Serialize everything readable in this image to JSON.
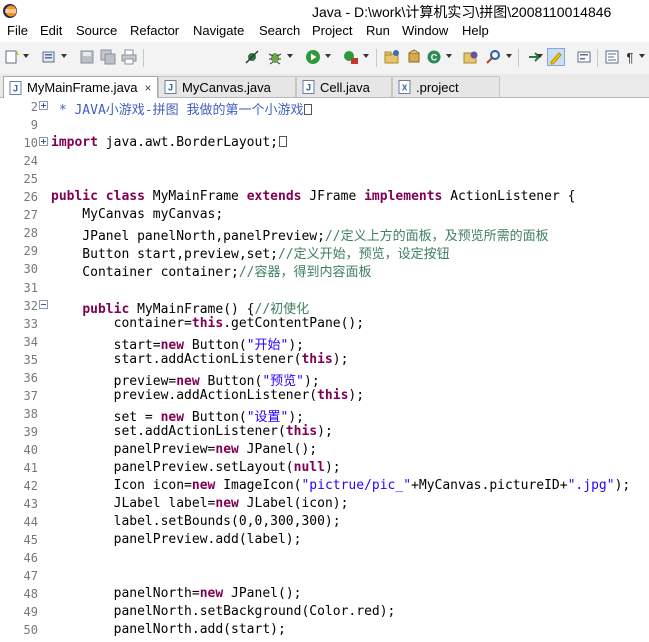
{
  "window": {
    "title": "Java - D:\\work\\计算机实习\\拼图\\2008110014846"
  },
  "menu": [
    "File",
    "Edit",
    "Source",
    "Refactor",
    "Navigate",
    "Search",
    "Project",
    "Run",
    "Window",
    "Help"
  ],
  "toolbar": {
    "icons": [
      "new-wizard-icon",
      "new-java-element-icon",
      "save-icon",
      "save-all-icon",
      "print-icon",
      "skip-breakpoints-icon",
      "debug-icon",
      "run-icon",
      "external-tools-icon",
      "new-java-project-icon",
      "new-package-icon",
      "new-class-icon",
      "open-type-icon",
      "search-icon",
      "toggle-mark-occurrences-icon",
      "show-whitespace-icon"
    ]
  },
  "tabs": [
    {
      "label": "MyMainFrame.java",
      "active": true,
      "icon": "java-file-icon",
      "close": "×"
    },
    {
      "label": "MyCanvas.java",
      "active": false,
      "icon": "java-file-icon"
    },
    {
      "label": "Cell.java",
      "active": false,
      "icon": "java-file-icon"
    },
    {
      "label": ".project",
      "active": false,
      "icon": "xml-file-icon"
    }
  ],
  "editor": {
    "lines": [
      {
        "n": "2",
        "fold": "plus",
        "parts": [
          {
            "t": " * JAVA小游戏-拼图 我做的第一个小游戏",
            "c": "jd"
          }
        ],
        "box": true
      },
      {
        "n": "9",
        "parts": []
      },
      {
        "n": "10",
        "fold": "plus",
        "parts": [
          {
            "t": "import",
            "c": "kw"
          },
          {
            "t": " java.awt.BorderLayout;",
            "c": ""
          }
        ],
        "box": true
      },
      {
        "n": "24",
        "parts": []
      },
      {
        "n": "25",
        "parts": []
      },
      {
        "n": "26",
        "parts": [
          {
            "t": "public",
            "c": "kw"
          },
          {
            "t": " ",
            "c": ""
          },
          {
            "t": "class",
            "c": "kw"
          },
          {
            "t": " MyMainFrame ",
            "c": ""
          },
          {
            "t": "extends",
            "c": "kw"
          },
          {
            "t": " JFrame ",
            "c": ""
          },
          {
            "t": "implements",
            "c": "kw"
          },
          {
            "t": " ActionListener {",
            "c": ""
          }
        ]
      },
      {
        "n": "27",
        "parts": [
          {
            "t": "    MyCanvas myCanvas;",
            "c": ""
          }
        ]
      },
      {
        "n": "28",
        "parts": [
          {
            "t": "    JPanel panelNorth,panelPreview;",
            "c": ""
          },
          {
            "t": "//定义上方的面板，及预览所需的面板",
            "c": "cm"
          }
        ]
      },
      {
        "n": "29",
        "parts": [
          {
            "t": "    Button start,preview,set;",
            "c": ""
          },
          {
            "t": "//定义开始，预览，设定按钮",
            "c": "cm"
          }
        ]
      },
      {
        "n": "30",
        "parts": [
          {
            "t": "    Container container;",
            "c": ""
          },
          {
            "t": "//容器，得到内容面板",
            "c": "cm"
          }
        ]
      },
      {
        "n": "31",
        "parts": []
      },
      {
        "n": "32",
        "fold": "minus",
        "parts": [
          {
            "t": "    ",
            "c": ""
          },
          {
            "t": "public",
            "c": "kw"
          },
          {
            "t": " MyMainFrame() {",
            "c": ""
          },
          {
            "t": "//初使化",
            "c": "cm"
          }
        ]
      },
      {
        "n": "33",
        "parts": [
          {
            "t": "        container=",
            "c": ""
          },
          {
            "t": "this",
            "c": "kw"
          },
          {
            "t": ".getContentPane();",
            "c": ""
          }
        ]
      },
      {
        "n": "34",
        "parts": [
          {
            "t": "        start=",
            "c": ""
          },
          {
            "t": "new",
            "c": "kw"
          },
          {
            "t": " Button(",
            "c": ""
          },
          {
            "t": "\"开始\"",
            "c": "st"
          },
          {
            "t": ");",
            "c": ""
          }
        ]
      },
      {
        "n": "35",
        "parts": [
          {
            "t": "        start.addActionListener(",
            "c": ""
          },
          {
            "t": "this",
            "c": "kw"
          },
          {
            "t": ");",
            "c": ""
          }
        ]
      },
      {
        "n": "36",
        "parts": [
          {
            "t": "        preview=",
            "c": ""
          },
          {
            "t": "new",
            "c": "kw"
          },
          {
            "t": " Button(",
            "c": ""
          },
          {
            "t": "\"预览\"",
            "c": "st"
          },
          {
            "t": ");",
            "c": ""
          }
        ]
      },
      {
        "n": "37",
        "parts": [
          {
            "t": "        preview.addActionListener(",
            "c": ""
          },
          {
            "t": "this",
            "c": "kw"
          },
          {
            "t": ");",
            "c": ""
          }
        ]
      },
      {
        "n": "38",
        "parts": [
          {
            "t": "        set = ",
            "c": ""
          },
          {
            "t": "new",
            "c": "kw"
          },
          {
            "t": " Button(",
            "c": ""
          },
          {
            "t": "\"设置\"",
            "c": "st"
          },
          {
            "t": ");",
            "c": ""
          }
        ]
      },
      {
        "n": "39",
        "parts": [
          {
            "t": "        set.addActionListener(",
            "c": ""
          },
          {
            "t": "this",
            "c": "kw"
          },
          {
            "t": ");",
            "c": ""
          }
        ]
      },
      {
        "n": "40",
        "parts": [
          {
            "t": "        panelPreview=",
            "c": ""
          },
          {
            "t": "new",
            "c": "kw"
          },
          {
            "t": " JPanel();",
            "c": ""
          }
        ]
      },
      {
        "n": "41",
        "parts": [
          {
            "t": "        panelPreview.setLayout(",
            "c": ""
          },
          {
            "t": "null",
            "c": "kw"
          },
          {
            "t": ");",
            "c": ""
          }
        ]
      },
      {
        "n": "42",
        "parts": [
          {
            "t": "        Icon icon=",
            "c": ""
          },
          {
            "t": "new",
            "c": "kw"
          },
          {
            "t": " ImageIcon(",
            "c": ""
          },
          {
            "t": "\"pictrue/pic_\"",
            "c": "st"
          },
          {
            "t": "+MyCanvas.pictureID+",
            "c": ""
          },
          {
            "t": "\".jpg\"",
            "c": "st"
          },
          {
            "t": ");",
            "c": ""
          }
        ]
      },
      {
        "n": "43",
        "parts": [
          {
            "t": "        JLabel label=",
            "c": ""
          },
          {
            "t": "new",
            "c": "kw"
          },
          {
            "t": " JLabel(icon);",
            "c": ""
          }
        ]
      },
      {
        "n": "44",
        "parts": [
          {
            "t": "        label.setBounds(0,0,300,300);",
            "c": ""
          }
        ]
      },
      {
        "n": "45",
        "parts": [
          {
            "t": "        panelPreview.add(label);",
            "c": ""
          }
        ]
      },
      {
        "n": "46",
        "parts": []
      },
      {
        "n": "47",
        "parts": []
      },
      {
        "n": "48",
        "parts": [
          {
            "t": "        panelNorth=",
            "c": ""
          },
          {
            "t": "new",
            "c": "kw"
          },
          {
            "t": " JPanel();",
            "c": ""
          }
        ]
      },
      {
        "n": "49",
        "parts": [
          {
            "t": "        panelNorth.setBackground(Color.red);",
            "c": ""
          }
        ]
      },
      {
        "n": "50",
        "parts": [
          {
            "t": "        panelNorth.add(start);",
            "c": ""
          }
        ]
      }
    ]
  },
  "colors": {
    "keyword": "#7f0055",
    "comment": "#3f7f5f",
    "javadoc": "#3f5fbf",
    "string": "#2a00ff",
    "line_number": "#787878"
  }
}
